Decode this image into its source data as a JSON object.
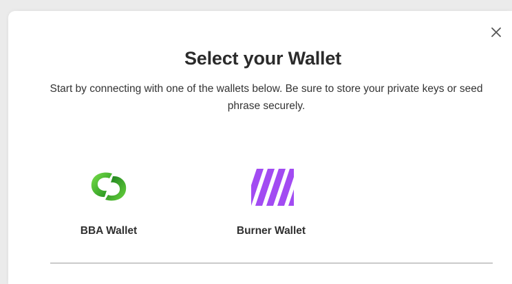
{
  "modal": {
    "title": "Select your Wallet",
    "subtitle": "Start by connecting with one of the wallets below. Be sure to store your private keys or seed phrase securely.",
    "close_icon": "close-icon"
  },
  "wallets": [
    {
      "label": "BBA Wallet",
      "icon": "bba-wallet-logo",
      "color": "#2fae2a"
    },
    {
      "label": "Burner Wallet",
      "icon": "burner-wallet-logo",
      "color": "#a24bf2"
    }
  ],
  "colors": {
    "title": "#2b2b2b",
    "divider": "#9a9a9a",
    "bba_green_light": "#5bd13f",
    "bba_green_dark": "#1e8a1c",
    "burner_purple": "#a24bf2"
  }
}
